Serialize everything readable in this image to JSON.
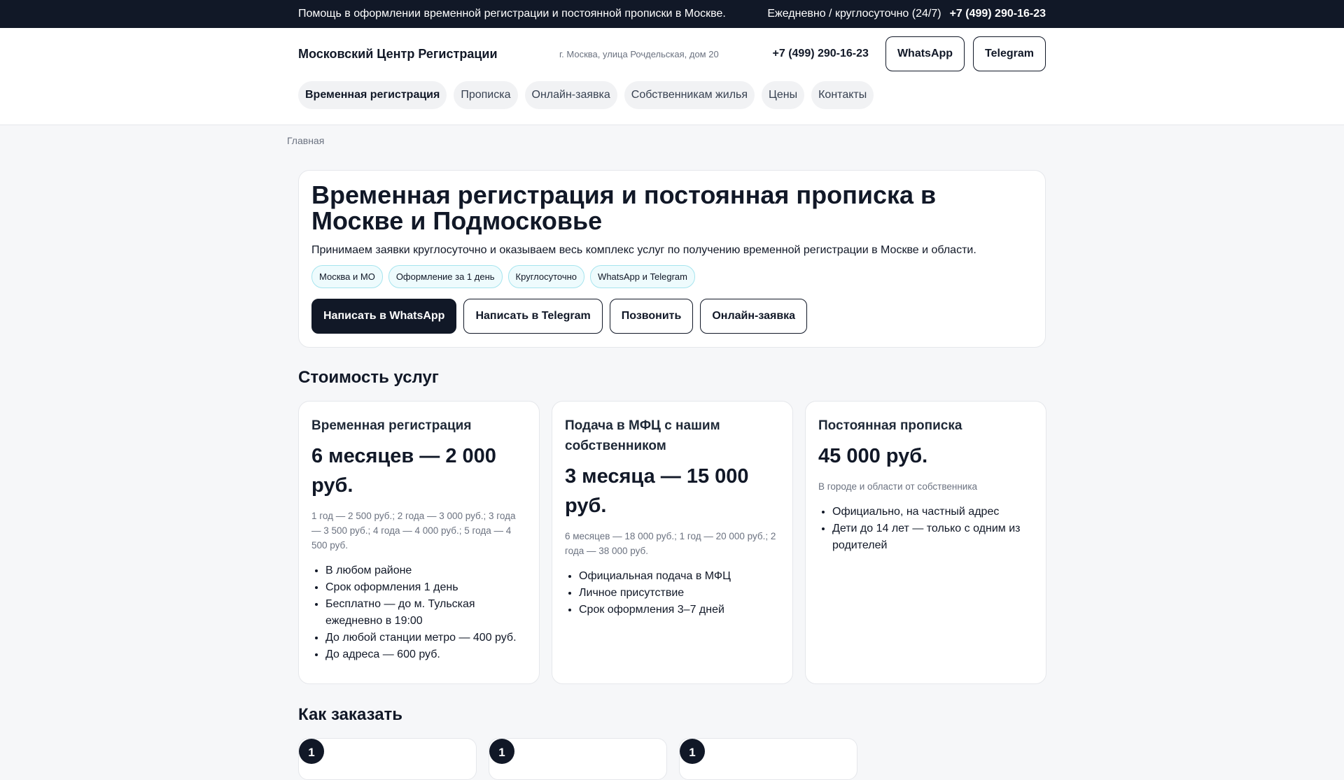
{
  "topbar": {
    "message": "Помощь в оформлении временной регистрации и постоянной прописки в Москве.",
    "hours": "Ежедневно / круглосуточно (24/7)",
    "phone": "+7 (499) 290-16-23"
  },
  "header": {
    "logo": "Московский Центр Регистрации",
    "address": "г. Москва, улица Рочдельская, дом 20",
    "phone": "+7 (499) 290-16-23",
    "whatsapp": "WhatsApp",
    "telegram": "Telegram"
  },
  "nav": [
    "Временная регистрация",
    "Прописка",
    "Онлайн-заявка",
    "Собственникам жилья",
    "Цены",
    "Контакты"
  ],
  "breadcrumb": "Главная",
  "hero": {
    "title": "Временная регистрация и постоянная прописка в Москве и Подмосковье",
    "subtitle": "Принимаем заявки круглосуточно и оказываем весь комплекс услуг по получению временной регистрации в Москве и области.",
    "chips": [
      "Москва и МО",
      "Оформление за 1 день",
      "Круглосуточно",
      "WhatsApp и Telegram"
    ],
    "buttons": [
      "Написать в WhatsApp",
      "Написать в Telegram",
      "Позвонить",
      "Онлайн-заявка"
    ]
  },
  "pricing": {
    "title": "Стоимость услуг",
    "cards": [
      {
        "title": "Временная регистрация",
        "price": "6 месяцев — 2 000 руб.",
        "note": "1 год — 2 500 руб.; 2 года — 3 000 руб.; 3 года — 3 500 руб.; 4 года — 4 000 руб.; 5 года — 4 500 руб.",
        "items": [
          "В любом районе",
          "Срок оформления 1 день",
          "Бесплатно — до м. Тульская ежедневно в 19:00",
          "До любой станции метро — 400 руб.",
          "До адреса — 600 руб."
        ]
      },
      {
        "title": "Подача в МФЦ с нашим собственником",
        "price": "3 месяца — 15 000 руб.",
        "note": "6 месяцев — 18 000 руб.; 1 год — 20 000 руб.; 2 года — 38 000 руб.",
        "items": [
          "Официальная подача в МФЦ",
          "Личное присутствие",
          "Срок оформления 3–7 дней"
        ]
      },
      {
        "title": "Постоянная прописка",
        "price": "45 000 руб.",
        "note": "В городе и области от собственника",
        "items": [
          "Официально, на частный адрес",
          "Дети до 14 лет — только с одним из родителей"
        ]
      }
    ]
  },
  "order": {
    "title": "Как заказать",
    "steps": [
      "1",
      "1",
      "1"
    ]
  }
}
